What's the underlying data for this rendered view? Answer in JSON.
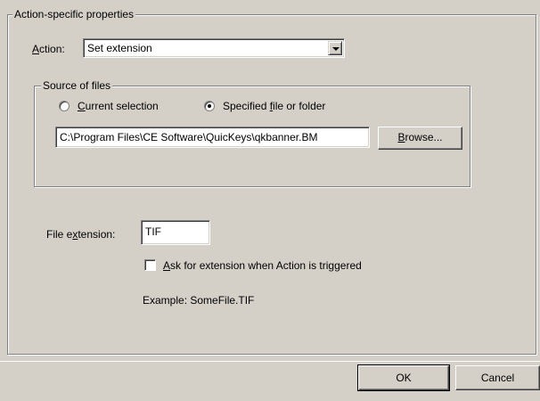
{
  "group_action": {
    "legend": "Action-specific properties"
  },
  "action": {
    "label_prefix": "",
    "label_u": "A",
    "label_rest": "ction:",
    "value": "Set extension"
  },
  "source_group": {
    "legend": "Source of files",
    "radio_current": {
      "u": "C",
      "rest": "urrent selection",
      "selected": false
    },
    "radio_specified": {
      "pre": "Specified ",
      "u": "f",
      "rest": "ile or folder",
      "selected": true
    },
    "path_value": "C:\\Program Files\\CE Software\\QuicKeys\\qkbanner.BM",
    "browse": {
      "u": "B",
      "rest": "rowse..."
    }
  },
  "extension": {
    "label_pre": "File e",
    "label_u": "x",
    "label_rest": "tension:",
    "value": "TIF",
    "ask_checkbox": {
      "u": "A",
      "rest": "sk for extension when Action is triggered",
      "checked": false
    },
    "example": "Example:  SomeFile.TIF"
  },
  "dialog_buttons": {
    "ok": "OK",
    "cancel": "Cancel"
  }
}
